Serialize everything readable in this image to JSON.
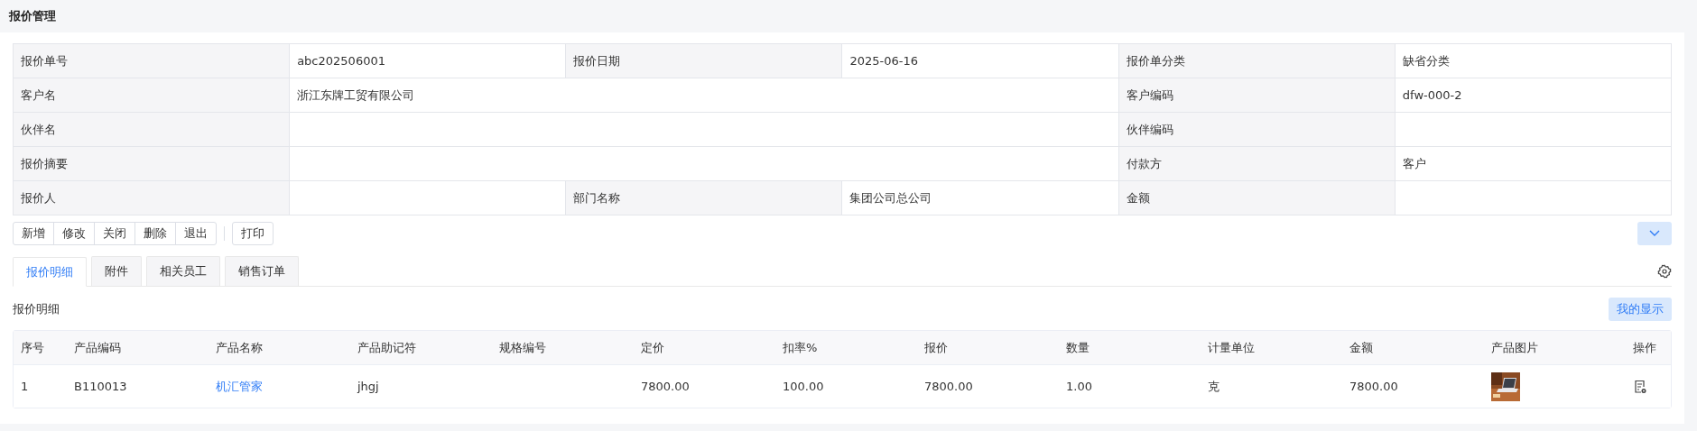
{
  "page_title": "报价管理",
  "form": {
    "rows": [
      [
        {
          "label": "报价单号",
          "value": "abc202506001"
        },
        {
          "label": "报价日期",
          "value": "2025-06-16"
        },
        {
          "label": "报价单分类",
          "value": "缺省分类"
        }
      ],
      [
        {
          "label": "客户名",
          "value": "浙江东牌工贸有限公司"
        },
        {
          "label": "客户编码",
          "value": "dfw-000-2"
        }
      ],
      [
        {
          "label": "伙伴名"
        },
        {
          "label": "伙伴编码"
        }
      ],
      [
        {
          "label": "报价摘要"
        },
        {
          "label": "付款方",
          "value": "客户"
        }
      ],
      [
        {
          "label": "报价人"
        },
        {
          "label": "部门名称",
          "value": "集团公司总公司"
        },
        {
          "label": "金额"
        }
      ]
    ]
  },
  "actions": {
    "group": [
      "新增",
      "修改",
      "关闭",
      "删除",
      "退出"
    ],
    "single": [
      "打印"
    ]
  },
  "tabs": [
    {
      "label": "报价明细",
      "selected": true
    },
    {
      "label": "附件",
      "selected": false
    },
    {
      "label": "相关员工",
      "selected": false
    },
    {
      "label": "销售订单",
      "selected": false
    }
  ],
  "section_title": "报价明细",
  "display_button": "我的显示",
  "table": {
    "columns": [
      "序号",
      "产品编码",
      "产品名称",
      "产品助记符",
      "规格编号",
      "定价",
      "扣率%",
      "报价",
      "数量",
      "计量单位",
      "金额",
      "产品图片",
      "操作"
    ],
    "rows": [
      {
        "cells": [
          "1",
          "B110013",
          "机汇管家",
          "jhgj",
          "",
          "7800.00",
          "100.00",
          "7800.00",
          "1.00",
          "克",
          "7800.00"
        ]
      }
    ]
  }
}
